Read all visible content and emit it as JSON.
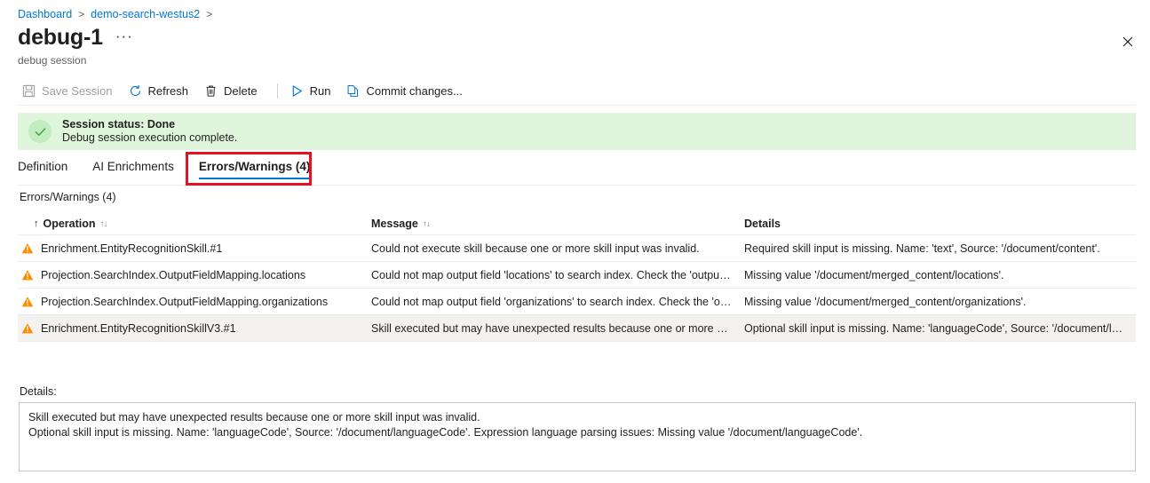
{
  "breadcrumb": {
    "items": [
      {
        "label": "Dashboard",
        "icon": "chevron-right-icon"
      },
      {
        "label": "demo-search-westus2",
        "icon": "chevron-right-icon"
      }
    ],
    "separator": ">"
  },
  "header": {
    "title": "debug-1",
    "subtitle": "debug session",
    "more_menu": "···",
    "close_icon": "close-icon"
  },
  "toolbar": {
    "items": [
      {
        "label": "Save Session",
        "icon": "save-icon",
        "disabled": true
      },
      {
        "label": "Refresh",
        "icon": "refresh-icon",
        "disabled": false
      },
      {
        "label": "Delete",
        "icon": "trash-icon",
        "disabled": false
      },
      {
        "label": "Run",
        "icon": "play-icon",
        "disabled": false
      },
      {
        "label": "Commit changes...",
        "icon": "copy-icon",
        "disabled": false
      }
    ]
  },
  "status_banner": {
    "icon": "check-circle-icon",
    "title": "Session status: Done",
    "message": "Debug session execution complete.",
    "background_color": "#dff6dd",
    "icon_color": "#107c10"
  },
  "tabs": [
    {
      "label": "Definition",
      "active": false
    },
    {
      "label": "AI Enrichments",
      "active": false
    },
    {
      "label": "Errors/Warnings (4)",
      "active": true
    }
  ],
  "annotation": {
    "type": "highlight-rectangle",
    "color": "#e81123",
    "target": "Errors/Warnings (4)"
  },
  "grid": {
    "caption": "Errors/Warnings (4)",
    "columns": [
      {
        "label": "Operation",
        "sorted": true,
        "sort_direction": "↑",
        "sort_icon": "↑↓"
      },
      {
        "label": "Message",
        "sorted": false,
        "sort_icon": "↑↓"
      },
      {
        "label": "Details",
        "sorted": false,
        "sort_icon": ""
      }
    ],
    "rows": [
      {
        "icon": "warning-icon",
        "operation": "Enrichment.EntityRecognitionSkill.#1",
        "message": "Could not execute skill because one or more skill input was invalid.",
        "details": "Required skill input is missing. Name: 'text', Source: '/document/content'.",
        "selected": false
      },
      {
        "icon": "warning-icon",
        "operation": "Projection.SearchIndex.OutputFieldMapping.locations",
        "message": "Could not map output field 'locations' to search index. Check the 'outputFi…",
        "details": "Missing value '/document/merged_content/locations'.",
        "selected": false
      },
      {
        "icon": "warning-icon",
        "operation": "Projection.SearchIndex.OutputFieldMapping.organizations",
        "message": "Could not map output field 'organizations' to search index. Check the 'outp…",
        "details": "Missing value '/document/merged_content/organizations'.",
        "selected": false
      },
      {
        "icon": "warning-icon",
        "operation": "Enrichment.EntityRecognitionSkillV3.#1",
        "message": "Skill executed but may have unexpected results because one or more skill i…",
        "details": "Optional skill input is missing. Name: 'languageCode', Source: '/document/l…",
        "selected": true
      }
    ],
    "warning_color": "#ff8c00"
  },
  "details_pane": {
    "label": "Details:",
    "line1": "Skill executed but may have unexpected results because one or more skill input was invalid.",
    "line2": "Optional skill input is missing. Name: 'languageCode', Source: '/document/languageCode'. Expression language parsing issues: Missing value '/document/languageCode'."
  },
  "colors": {
    "accent": "#0078d4",
    "warning": "#ff8c00",
    "success": "#107c10",
    "annotation": "#e81123"
  }
}
